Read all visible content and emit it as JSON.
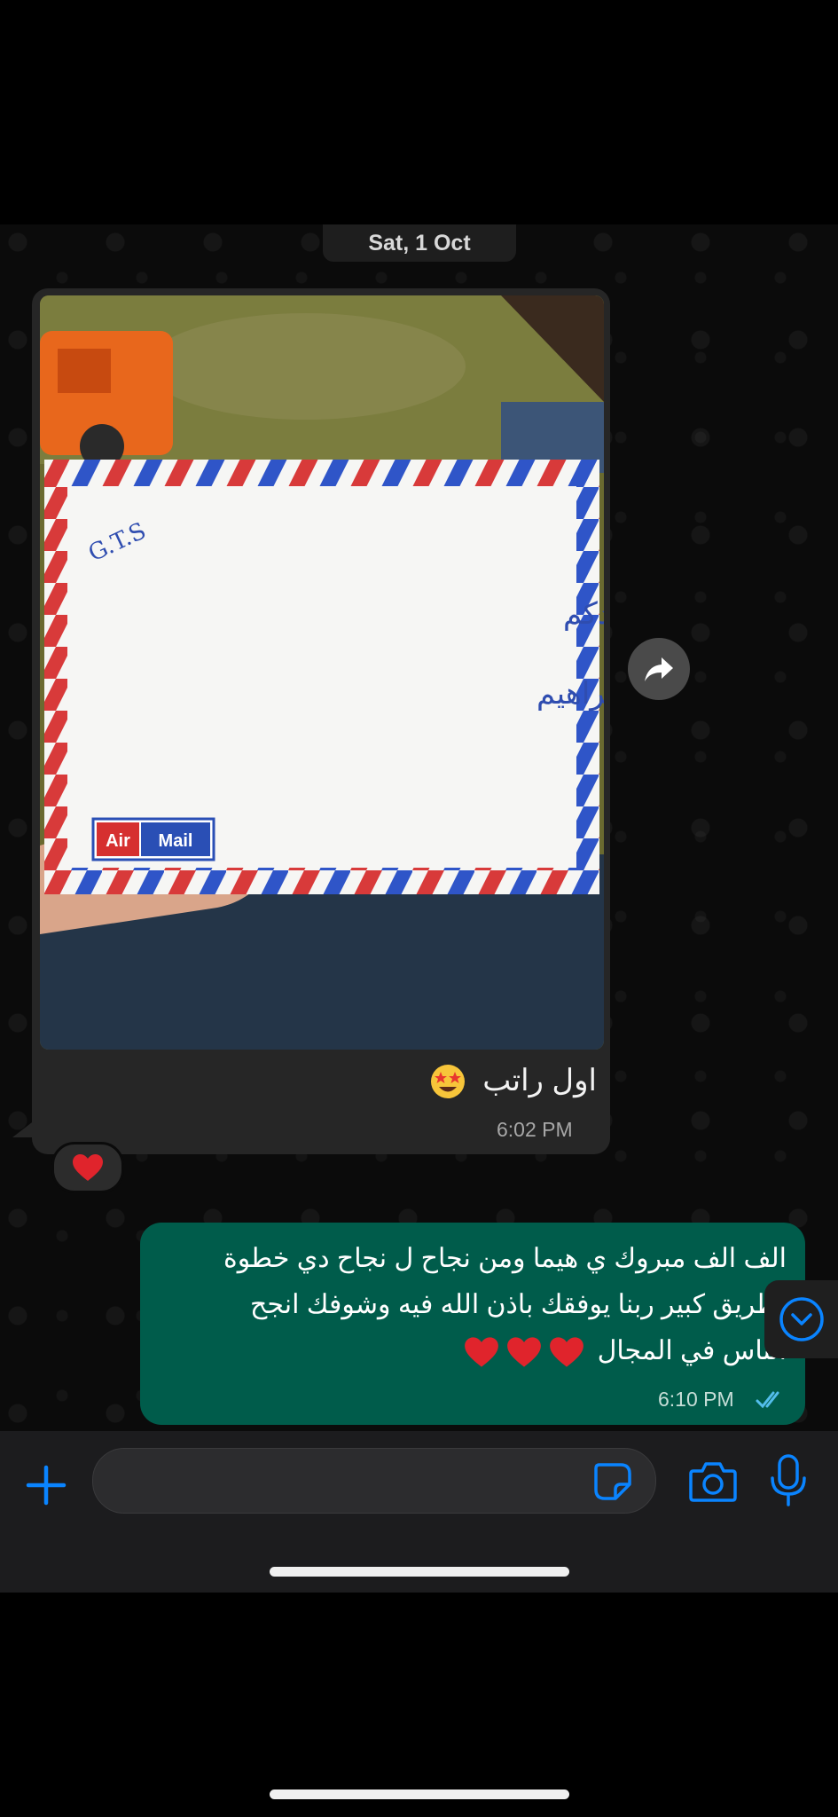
{
  "date_separator": "Sat, 1 Oct",
  "incoming": {
    "caption": "اول راتب",
    "caption_emoji": "star-struck-emoji",
    "time": "6:02 PM",
    "reaction": "red-heart",
    "photo": {
      "envelope_label": "Air Mail",
      "handwriting_1": "G.T.S",
      "handwriting_2": "شكرا لمجهودكم",
      "handwriting_3": "م / محمد ابراهيم"
    }
  },
  "outgoing": {
    "text": "الف الف مبروك ي هيما ومن نجاح ل نجاح دي خطوة لطريق كبير ربنا يوفقك باذن الله فيه وشوفك انجح الناس في المجال",
    "hearts_count": 3,
    "time": "6:10 PM",
    "status": "read"
  },
  "colors": {
    "outgoing_bubble": "#005c4b",
    "incoming_bubble": "#262626",
    "accent_blue": "#0a84ff",
    "read_ticks": "#53bdeb"
  },
  "icons": {
    "forward": "forward-icon",
    "scroll_down": "chevron-down-circle-icon",
    "attach": "plus-icon",
    "sticker": "sticker-icon",
    "camera": "camera-icon",
    "mic": "microphone-icon"
  }
}
